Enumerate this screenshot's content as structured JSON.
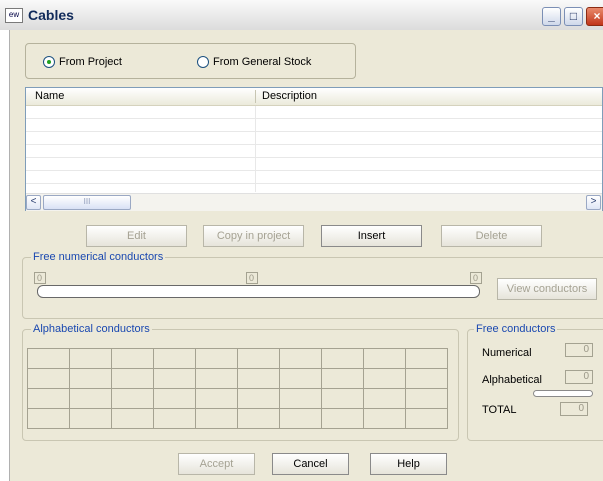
{
  "window": {
    "app_icon": "ew",
    "title": "Cables",
    "minimize_glyph": "_",
    "maximize_glyph": "□",
    "close_glyph": "×"
  },
  "source": {
    "options": [
      {
        "label": "From Project",
        "selected": true
      },
      {
        "label": "From General Stock",
        "selected": false
      }
    ]
  },
  "list": {
    "columns": [
      "Name",
      "Description"
    ],
    "rows": [],
    "scroll_left": "<",
    "scroll_right": ">",
    "thumb_grip": "III"
  },
  "actions": {
    "edit": "Edit",
    "copy": "Copy in project",
    "insert": "Insert",
    "delete": "Delete"
  },
  "free_numerical": {
    "label": "Free numerical conductors",
    "left_value": "0",
    "mid_value": "0",
    "right_value": "0",
    "progress": 0,
    "view_button": "View conductors"
  },
  "alphabetical": {
    "label": "Alphabetical conductors",
    "grid_rows": 4,
    "grid_cols": 10
  },
  "free_conductors": {
    "label": "Free conductors",
    "numerical_label": "Numerical",
    "numerical_value": "0",
    "alphabetical_label": "Alphabetical",
    "alphabetical_value": "0",
    "total_label": "TOTAL",
    "total_value": "0"
  },
  "footer": {
    "accept": "Accept",
    "cancel": "Cancel",
    "help": "Help"
  },
  "colors": {
    "group_label": "#1a48b0",
    "dialog_bg": "#ece9d8"
  }
}
